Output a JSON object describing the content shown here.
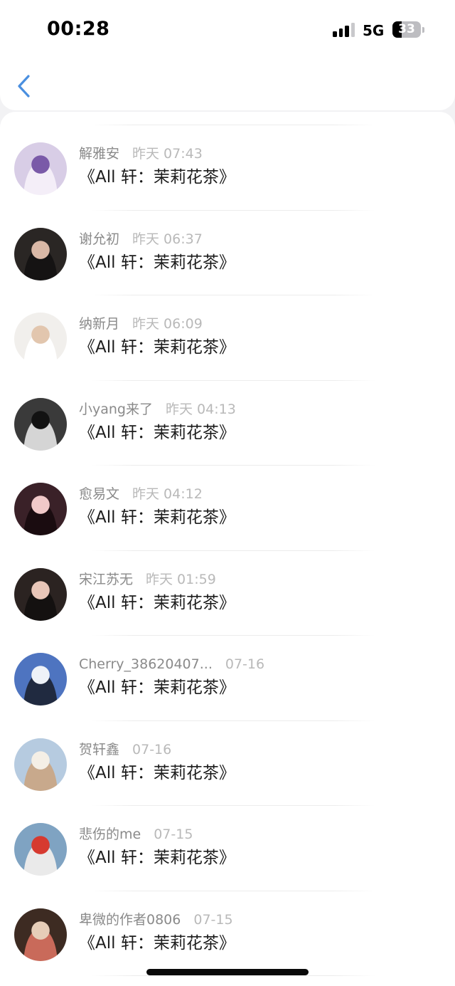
{
  "status_bar": {
    "time": "00:28",
    "network": "5G",
    "battery": "33",
    "battery_level": 0.33,
    "signal_bars": 3
  },
  "nav": {
    "back_icon": "chevron-left-icon",
    "accent_color": "#4a8fe0"
  },
  "items": [
    {
      "name": "解雅安",
      "date": "昨天 07:43",
      "title": "《All 轩：茉莉花茶》",
      "avatar_colors": [
        "#d8cde6",
        "#7a5aa8",
        "#f4eef8"
      ]
    },
    {
      "name": "谢允初",
      "date": "昨天 06:37",
      "title": "《All 轩：茉莉花茶》",
      "avatar_colors": [
        "#2a2624",
        "#d9b8a6",
        "#151313"
      ]
    },
    {
      "name": "纳新月",
      "date": "昨天 06:09",
      "title": "《All 轩：茉莉花茶》",
      "avatar_colors": [
        "#f1efec",
        "#e2c6ae",
        "#ffffff"
      ]
    },
    {
      "name": "小yang来了",
      "date": "昨天 04:13",
      "title": "《All 轩：茉莉花茶》",
      "avatar_colors": [
        "#3a3a3a",
        "#121212",
        "#d5d5d5"
      ]
    },
    {
      "name": "愈易文",
      "date": "昨天 04:12",
      "title": "《All 轩：茉莉花茶》",
      "avatar_colors": [
        "#3a2128",
        "#f1c9c9",
        "#1a0c10"
      ]
    },
    {
      "name": "宋江苏无",
      "date": "昨天 01:59",
      "title": "《All 轩：茉莉花茶》",
      "avatar_colors": [
        "#2b2321",
        "#e8c6b8",
        "#141110"
      ]
    },
    {
      "name": "Cherry_38620407...",
      "date": "07-16",
      "title": "《All 轩：茉莉花茶》",
      "avatar_colors": [
        "#4e74c0",
        "#eef2f8",
        "#202a40"
      ]
    },
    {
      "name": "贺轩鑫",
      "date": "07-16",
      "title": "《All 轩：茉莉花茶》",
      "avatar_colors": [
        "#b6cbe0",
        "#f4efe6",
        "#c8a98c"
      ]
    },
    {
      "name": "悲伤的me",
      "date": "07-15",
      "title": "《All 轩：茉莉花茶》",
      "avatar_colors": [
        "#7fa3c2",
        "#d63a30",
        "#eaeaea"
      ]
    },
    {
      "name": "卑微的作者0806",
      "date": "07-15",
      "title": "《All 轩：茉莉花茶》",
      "avatar_colors": [
        "#3d2b22",
        "#e6cdb8",
        "#c96a5a"
      ]
    }
  ]
}
